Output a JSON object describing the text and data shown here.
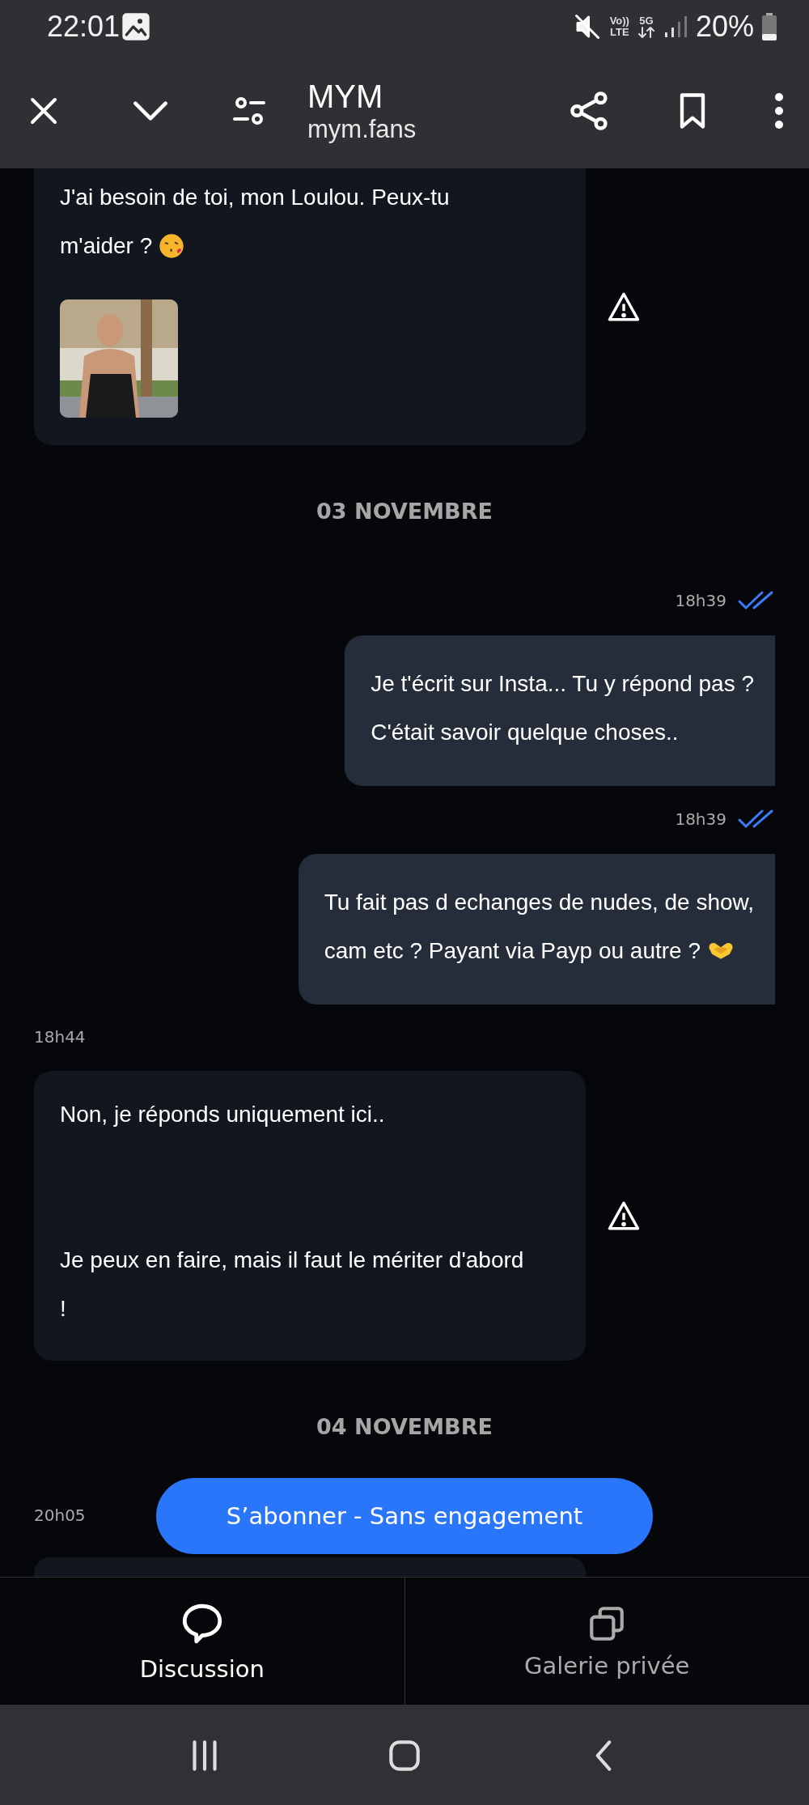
{
  "status_bar": {
    "time": "22:01",
    "volte": "Vo))",
    "volte_sub": "LTE",
    "network": "5G",
    "battery": "20%"
  },
  "browser_bar": {
    "title": "MYM",
    "url": "mym.fans"
  },
  "messages": [
    {
      "kind": "received",
      "lines": [
        "J'ai besoin de toi, mon Loulou. Peux-tu",
        "m'aider ?"
      ],
      "emoji": {
        "kind": "kiss"
      },
      "picture": true,
      "warning": true
    },
    {
      "kind": "date",
      "text": "03 NOVEMBRE"
    },
    {
      "kind": "sent_time",
      "text": "18h39",
      "read": true
    },
    {
      "kind": "sent",
      "lines": [
        "Je t'écrit sur Insta... Tu y répond pas ?",
        "C'était savoir quelque choses.."
      ]
    },
    {
      "kind": "sent_time",
      "text": "18h39",
      "read": true
    },
    {
      "kind": "sent",
      "lines": [
        "Tu fait pas d echanges de nudes, de show,",
        "cam etc ? Payant via Payp ou autre ?"
      ],
      "emoji": {
        "kind": "heart-hands"
      }
    },
    {
      "kind": "received_time",
      "text": "18h44"
    },
    {
      "kind": "received",
      "paragraphs": [
        [
          "Non, je réponds uniquement ici.."
        ],
        [
          "Je peux en faire, mais il faut le mériter d'abord",
          "!"
        ]
      ],
      "warning": true
    },
    {
      "kind": "date",
      "text": "04 NOVEMBRE"
    },
    {
      "kind": "received_time",
      "text": "20h05"
    }
  ],
  "subscribe_button": "S’abonner - Sans engagement",
  "tabs": [
    {
      "label": "Discussion",
      "selected": true,
      "kind": "chat"
    },
    {
      "label": "Galerie privée",
      "selected": false,
      "kind": "gallery"
    }
  ]
}
